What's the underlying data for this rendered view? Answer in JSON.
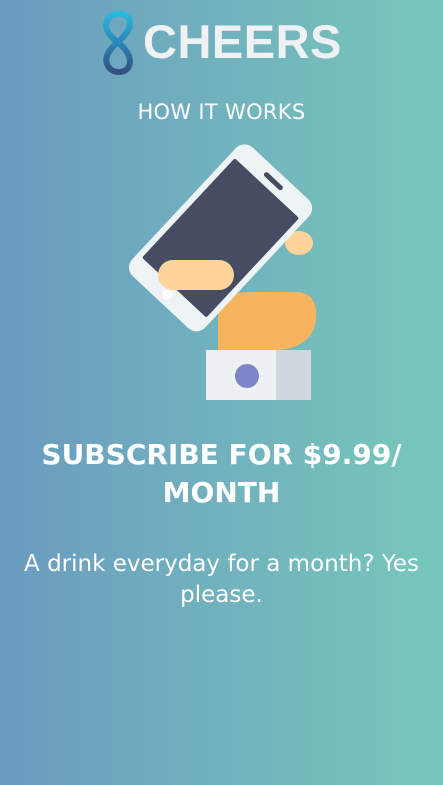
{
  "brand": {
    "name": "CHEERS",
    "logo_icon": "infinity-eight-icon",
    "colors": {
      "logo_gradient_top": "#2ab0d6",
      "logo_gradient_bottom": "#2d5d8f",
      "text": "#ffffff",
      "background_left": "#6a9bbf",
      "background_right": "#77c8bb"
    }
  },
  "section": {
    "heading": "HOW IT WORKS"
  },
  "illustration": {
    "icon": "hand-holding-phone-icon"
  },
  "plan": {
    "title": "SUBSCRIBE FOR $9.99/ MONTH",
    "description": "A drink everyday for a month? Yes please."
  }
}
